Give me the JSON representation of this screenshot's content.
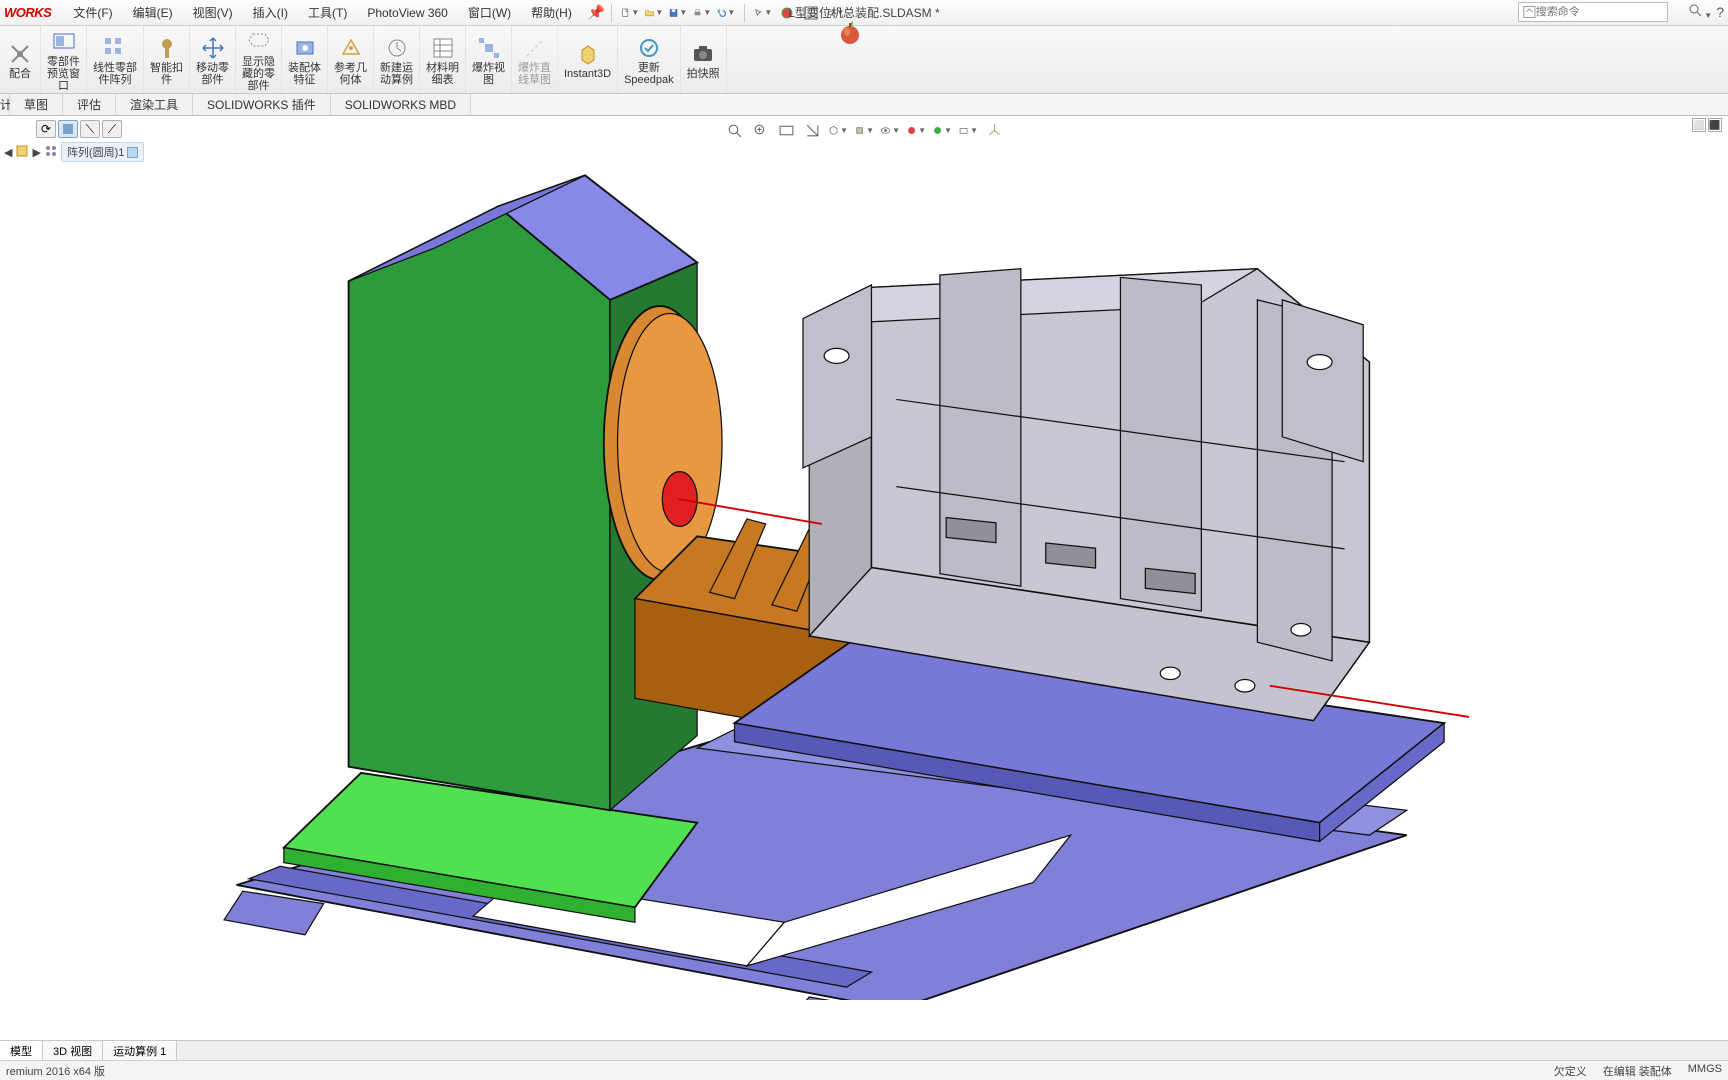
{
  "app": {
    "logo": "WORKS",
    "doc_title": "L型变位机总装配.SLDASM *"
  },
  "menu": {
    "file": "文件(F)",
    "edit": "编辑(E)",
    "view": "视图(V)",
    "insert": "插入(I)",
    "tools": "工具(T)",
    "photoview": "PhotoView 360",
    "window": "窗口(W)",
    "help": "帮助(H)"
  },
  "search": {
    "placeholder": "搜索命令"
  },
  "ribbon": {
    "mate": "配合",
    "preview": "零部件\n预览窗\n口",
    "linear_pattern": "线性零部\n件阵列",
    "smart_fastener": "智能扣\n件",
    "move_component": "移动零\n部件",
    "show_hidden": "显示隐\n藏的零\n部件",
    "assembly_feature": "装配体\n特征",
    "ref_geometry": "参考几\n何体",
    "new_motion": "新建运\n动算例",
    "bom": "材料明\n细表",
    "exploded": "爆炸视\n图",
    "exploded_line": "爆炸直\n线草图",
    "instant3d": "Instant3D",
    "update_speedpak": "更新\nSpeedpak",
    "snapshot": "拍快照"
  },
  "ribbon_tabs": {
    "t1": "计",
    "t2": "草图",
    "t3": "评估",
    "t4": "渲染工具",
    "t5": "SOLIDWORKS 插件",
    "t6": "SOLIDWORKS MBD"
  },
  "breadcrumb": {
    "item": "阵列(圆周)1"
  },
  "bottom_tabs": {
    "model": "模型",
    "view3d": "3D 视图",
    "motion1": "运动算例 1"
  },
  "status": {
    "left": "remium 2016 x64 版",
    "underdefined": "欠定义",
    "editing": "在编辑 装配体",
    "units": "MMGS"
  }
}
